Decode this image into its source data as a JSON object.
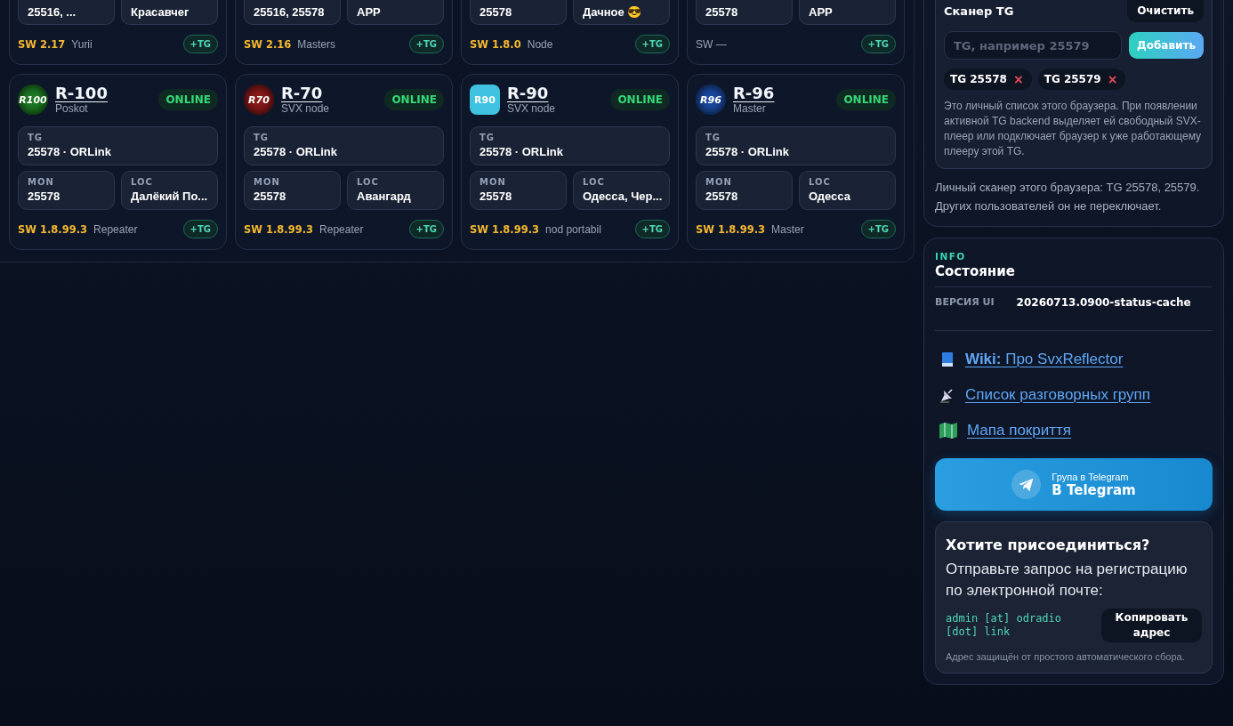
{
  "cards": [
    {
      "kind": "clipped",
      "mon": "25516, ...",
      "loc": "Красавчег",
      "sw": "SW 2.17",
      "sw_known": true,
      "role": "Yurii",
      "add": "+TG"
    },
    {
      "kind": "clipped",
      "mon": "25516, 25578",
      "loc": "APP",
      "sw": "SW 2.16",
      "sw_known": true,
      "role": "Masters",
      "add": "+TG"
    },
    {
      "kind": "clipped",
      "mon": "25578",
      "loc": "Дачное 😎",
      "sw": "SW 1.8.0",
      "sw_known": true,
      "role": "Node",
      "add": "+TG"
    },
    {
      "kind": "clipped",
      "mon": "25578",
      "loc": "APP",
      "sw": "SW —",
      "sw_known": false,
      "add": "+TG"
    },
    {
      "kind": "full",
      "avatar": {
        "kind": "round",
        "label": "R100",
        "color": "#1e7a24"
      },
      "name": "R-100",
      "subtitle": "Poskot",
      "status": "ONLINE",
      "tg_label": "TG",
      "tg": "25578 · ORLink",
      "mon_label": "MON",
      "mon": "25578",
      "loc_label": "LOC",
      "loc": "Далёкий По...",
      "sw": "SW 1.8.99.3",
      "sw_known": true,
      "role": "Repeater",
      "add": "+TG"
    },
    {
      "kind": "full",
      "avatar": {
        "kind": "round",
        "label": "R70",
        "color": "#8a1a1a"
      },
      "name": "R-70",
      "subtitle": "SVX node",
      "status": "ONLINE",
      "tg_label": "TG",
      "tg": "25578 · ORLink",
      "mon_label": "MON",
      "mon": "25578",
      "loc_label": "LOC",
      "loc": "Авангард",
      "sw": "SW 1.8.99.3",
      "sw_known": true,
      "role": "Repeater",
      "add": "+TG"
    },
    {
      "kind": "full",
      "avatar": {
        "kind": "tile",
        "label": "R90",
        "color": "#3fc3e0"
      },
      "name": "R-90",
      "subtitle": "SVX node",
      "status": "ONLINE",
      "tg_label": "TG",
      "tg": "25578 · ORLink",
      "mon_label": "MON",
      "mon": "25578",
      "loc_label": "LOC",
      "loc": "Одесса, Чер...",
      "sw": "SW 1.8.99.3",
      "sw_known": true,
      "role": "nod portabil",
      "add": "+TG"
    },
    {
      "kind": "full",
      "avatar": {
        "kind": "round",
        "label": "R96",
        "color": "#1a4aa0"
      },
      "name": "R-96",
      "subtitle": "Master",
      "status": "ONLINE",
      "tg_label": "TG",
      "tg": "25578 · ORLink",
      "mon_label": "MON",
      "mon": "25578",
      "loc_label": "LOC",
      "loc": "Одесса",
      "sw": "SW 1.8.99.3",
      "sw_known": true,
      "role": "Master",
      "add": "+TG"
    }
  ],
  "scanner": {
    "title": "Сканер TG",
    "clear": "Очистить",
    "placeholder": "TG, например 25579",
    "add": "Добавить",
    "chips": [
      {
        "label": "TG 25578",
        "remove": "×"
      },
      {
        "label": "TG 25579",
        "remove": "×"
      }
    ],
    "note": "Это личный список этого браузера. При появлении активной TG backend выделяет ей свободный SVX-плеер или подключает браузер к уже работающему плееру этой TG.",
    "summary": "Личный сканер этого браузера: TG 25578, 25579. Других пользователей он не переключает."
  },
  "info": {
    "eyebrow": "INFO",
    "title": "Состояние",
    "version_label": "ВЕРСИЯ UI",
    "version": "20260713.0900-status-cache",
    "links": [
      {
        "kind": "book",
        "text": "**Wiki:** Про SvxReflector"
      },
      {
        "kind": "dish",
        "text": "Список разговорных групп"
      },
      {
        "kind": "map",
        "text": "Мапа покриття"
      }
    ],
    "telegram": {
      "caption": "Група в Telegram",
      "label": "В Telegram"
    },
    "join": {
      "title": "Хотите присоединиться?",
      "text": "Отправьте запрос на регистрацию по электронной почте:",
      "email": "admin [at] odradio [dot] link",
      "copy": "Копировать адрес",
      "note": "Адрес защищён от простого автоматического сбора."
    }
  }
}
